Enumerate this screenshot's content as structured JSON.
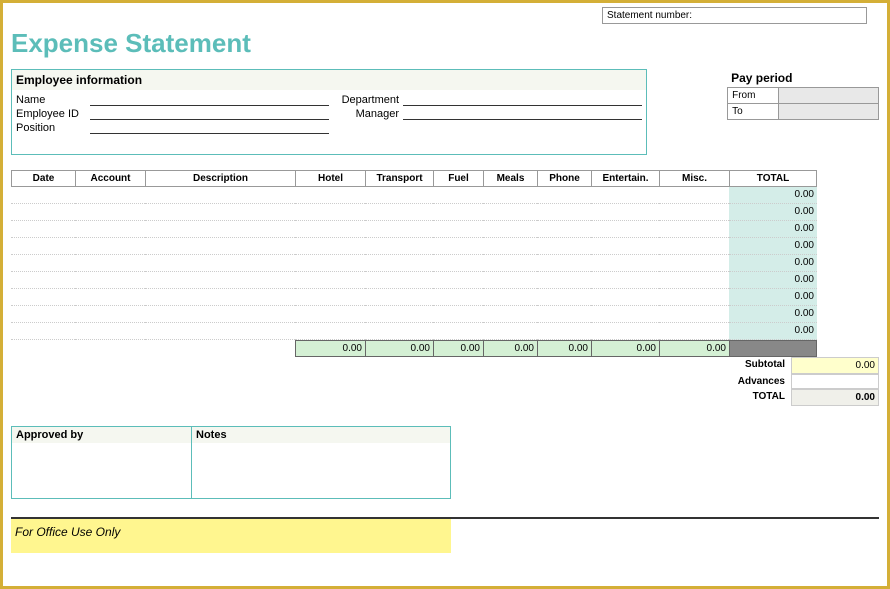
{
  "statement_number_label": "Statement number:",
  "title": "Expense Statement",
  "employee": {
    "header": "Employee information",
    "name_label": "Name",
    "id_label": "Employee ID",
    "position_label": "Position",
    "department_label": "Department",
    "manager_label": "Manager"
  },
  "pay_period": {
    "header": "Pay period",
    "from_label": "From",
    "to_label": "To"
  },
  "columns": {
    "date": "Date",
    "account": "Account",
    "description": "Description",
    "hotel": "Hotel",
    "transport": "Transport",
    "fuel": "Fuel",
    "meals": "Meals",
    "phone": "Phone",
    "entertain": "Entertain.",
    "misc": "Misc.",
    "total": "TOTAL"
  },
  "row_totals": [
    "0.00",
    "0.00",
    "0.00",
    "0.00",
    "0.00",
    "0.00",
    "0.00",
    "0.00",
    "0.00"
  ],
  "col_subtotals": {
    "hotel": "0.00",
    "transport": "0.00",
    "fuel": "0.00",
    "meals": "0.00",
    "phone": "0.00",
    "entertain": "0.00",
    "misc": "0.00"
  },
  "summary": {
    "subtotal_label": "Subtotal",
    "subtotal_value": "0.00",
    "advances_label": "Advances",
    "advances_value": "",
    "total_label": "TOTAL",
    "total_value": "0.00"
  },
  "approved": {
    "approved_label": "Approved by",
    "notes_label": "Notes"
  },
  "office_use": "For Office Use Only"
}
